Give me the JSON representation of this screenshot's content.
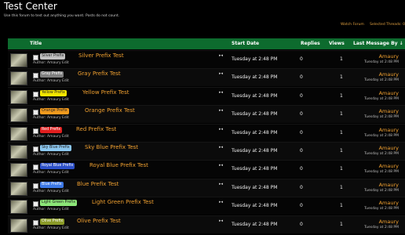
{
  "forum": {
    "title": "Test Center",
    "description": "Use this forum to test out anything you want. Posts do not count.",
    "links": [
      "Watch Forum",
      "Selected Threads: 0"
    ]
  },
  "columns": {
    "title": "Title",
    "start_date": "Start Date",
    "replies": "Replies",
    "views": "Views",
    "last_message": "Last Message By ↓"
  },
  "threads": [
    {
      "prefix": "Silver Prefix",
      "title": "Silver Prefix Test",
      "author": "Author: Amaury Edit",
      "start_date": "Tuesday at 2:48 PM",
      "replies": "0",
      "views": "1",
      "last_user": "Amaury",
      "last_date": "Tuesday at 2:48 PM",
      "prefix_bg": "#c0c0c0",
      "prefix_fg": "#222222"
    },
    {
      "prefix": "Gray Prefix",
      "title": "Gray Prefix Test",
      "author": "Author: Amaury Edit",
      "start_date": "Tuesday at 2:48 PM",
      "replies": "0",
      "views": "1",
      "last_user": "Amaury",
      "last_date": "Tuesday at 2:48 PM",
      "prefix_bg": "#808080",
      "prefix_fg": "#ffffff"
    },
    {
      "prefix": "Yellow Prefix",
      "title": "Yellow Prefix Test",
      "author": "Author: Amaury Edit",
      "start_date": "Tuesday at 2:48 PM",
      "replies": "0",
      "views": "1",
      "last_user": "Amaury",
      "last_date": "Tuesday at 2:48 PM",
      "prefix_bg": "#f5e600",
      "prefix_fg": "#222222"
    },
    {
      "prefix": "Orange Prefix",
      "title": "Orange Prefix Test",
      "author": "Author: Amaury Edit",
      "start_date": "Tuesday at 2:48 PM",
      "replies": "0",
      "views": "1",
      "last_user": "Amaury",
      "last_date": "Tuesday at 2:48 PM",
      "prefix_bg": "#f29a1e",
      "prefix_fg": "#222222"
    },
    {
      "prefix": "Red Prefix",
      "title": "Red Prefix Test",
      "author": "Author: Amaury Edit",
      "start_date": "Tuesday at 2:48 PM",
      "replies": "0",
      "views": "1",
      "last_user": "Amaury",
      "last_date": "Tuesday at 2:48 PM",
      "prefix_bg": "#e01e1e",
      "prefix_fg": "#ffffff"
    },
    {
      "prefix": "Sky Blue Prefix",
      "title": "Sky Blue Prefix Test",
      "author": "Author: Amaury Edit",
      "start_date": "Tuesday at 2:48 PM",
      "replies": "0",
      "views": "1",
      "last_user": "Amaury",
      "last_date": "Tuesday at 2:48 PM",
      "prefix_bg": "#8cc8f0",
      "prefix_fg": "#222222"
    },
    {
      "prefix": "Royal Blue Prefix",
      "title": "Royal Blue Prefix Test",
      "author": "Author: Amaury Edit",
      "start_date": "Tuesday at 2:48 PM",
      "replies": "0",
      "views": "1",
      "last_user": "Amaury",
      "last_date": "Tuesday at 2:48 PM",
      "prefix_bg": "#2d50c8",
      "prefix_fg": "#ffffff"
    },
    {
      "prefix": "Blue Prefix",
      "title": "Blue Prefix Test",
      "author": "Author: Amaury Edit",
      "start_date": "Tuesday at 2:48 PM",
      "replies": "0",
      "views": "1",
      "last_user": "Amaury",
      "last_date": "Tuesday at 2:48 PM",
      "prefix_bg": "#3c78e6",
      "prefix_fg": "#ffffff"
    },
    {
      "prefix": "Light Green Prefix",
      "title": "Light Green Prefix Test",
      "author": "Author: Amaury Edit",
      "start_date": "Tuesday at 2:48 PM",
      "replies": "0",
      "views": "1",
      "last_user": "Amaury",
      "last_date": "Tuesday at 2:48 PM",
      "prefix_bg": "#8ce678",
      "prefix_fg": "#222222"
    },
    {
      "prefix": "Olive Prefix",
      "title": "Olive Prefix Test",
      "author": "Author: Amaury Edit",
      "start_date": "Tuesday at 2:48 PM",
      "replies": "0",
      "views": "1",
      "last_user": "Amaury",
      "last_date": "Tuesday at 2:48 PM",
      "prefix_bg": "#8a9a28",
      "prefix_fg": "#ffffff"
    }
  ]
}
